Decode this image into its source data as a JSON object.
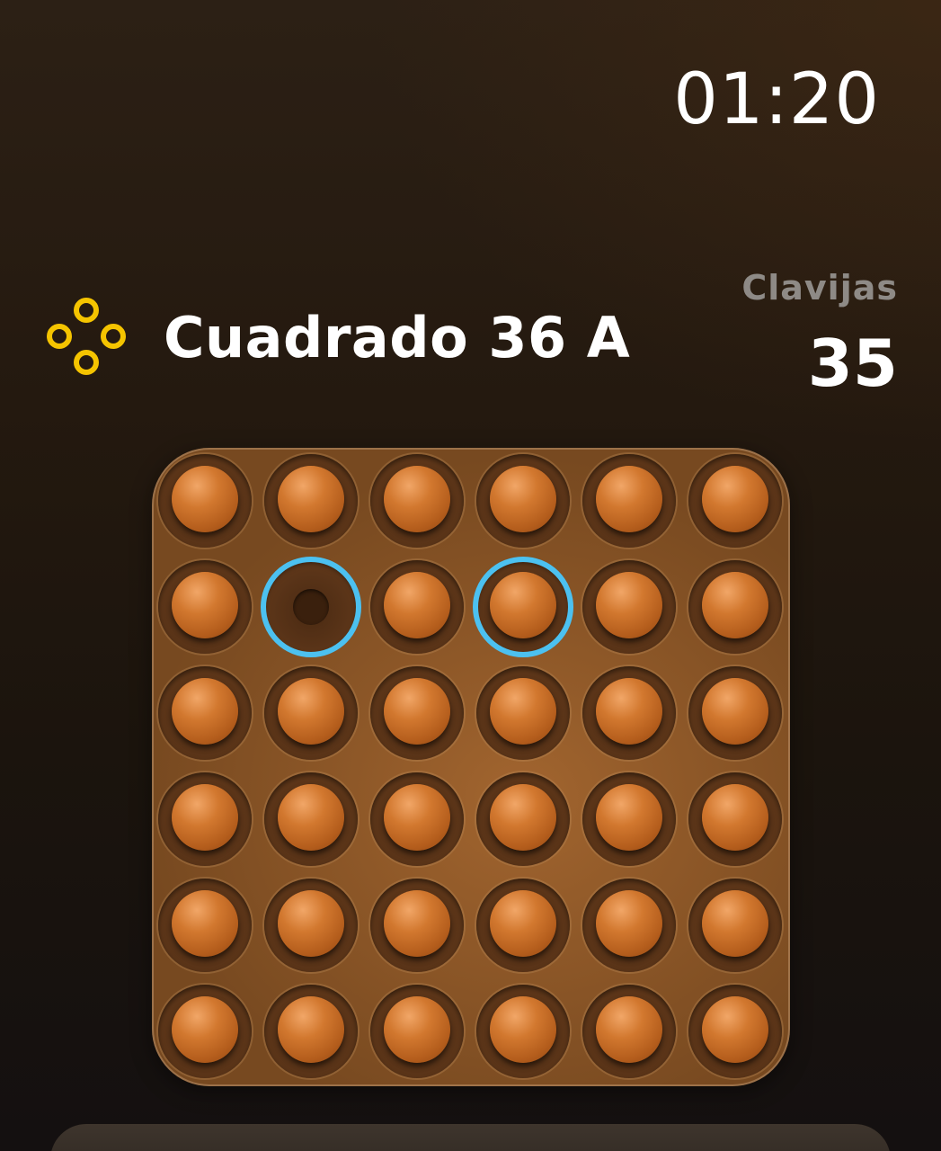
{
  "status": {
    "time": "01:20"
  },
  "header": {
    "icon": "peg-board-icon",
    "icon_color": "#f5c400",
    "title": "Cuadrado 36 A"
  },
  "stats": {
    "label": "Clavijas",
    "count": "35"
  },
  "board": {
    "rows": 6,
    "cols": 6,
    "peg_color": "#d2782f",
    "selection_color": "#4cc1f0",
    "cells": [
      [
        1,
        1,
        1,
        1,
        1,
        1
      ],
      [
        1,
        0,
        1,
        1,
        1,
        1
      ],
      [
        1,
        1,
        1,
        1,
        1,
        1
      ],
      [
        1,
        1,
        1,
        1,
        1,
        1
      ],
      [
        1,
        1,
        1,
        1,
        1,
        1
      ],
      [
        1,
        1,
        1,
        1,
        1,
        1
      ]
    ],
    "highlighted": [
      {
        "row": 1,
        "col": 1
      },
      {
        "row": 1,
        "col": 3
      }
    ]
  }
}
